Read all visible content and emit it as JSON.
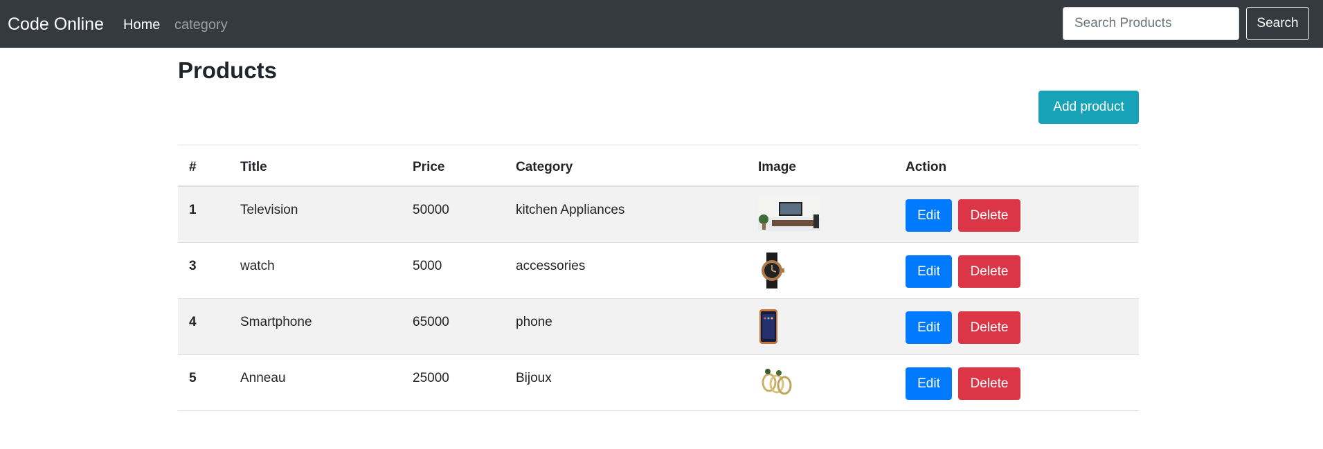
{
  "navbar": {
    "brand": "Code Online",
    "links": [
      {
        "label": "Home"
      },
      {
        "label": "category"
      }
    ],
    "search": {
      "placeholder": "Search Products",
      "value": "",
      "button_label": "Search"
    }
  },
  "main": {
    "title": "Products",
    "add_button_label": "Add product",
    "table": {
      "columns": [
        "#",
        "Title",
        "Price",
        "Category",
        "Image",
        "Action"
      ],
      "rows": [
        {
          "id": "1",
          "title": "Television",
          "price": "50000",
          "category": "kitchen Appliances",
          "image": "television-thumbnail",
          "edit_label": "Edit",
          "delete_label": "Delete"
        },
        {
          "id": "3",
          "title": "watch",
          "price": "5000",
          "category": "accessories",
          "image": "watch-thumbnail",
          "edit_label": "Edit",
          "delete_label": "Delete"
        },
        {
          "id": "4",
          "title": "Smartphone",
          "price": "65000",
          "category": "phone",
          "image": "smartphone-thumbnail",
          "edit_label": "Edit",
          "delete_label": "Delete"
        },
        {
          "id": "5",
          "title": "Anneau",
          "price": "25000",
          "category": "Bijoux",
          "image": "ring-thumbnail",
          "edit_label": "Edit",
          "delete_label": "Delete"
        }
      ]
    }
  },
  "colors": {
    "navbar_bg": "#343a40",
    "info": "#17a2b8",
    "primary": "#007bff",
    "danger": "#dc3545",
    "stripe": "#f2f2f2"
  }
}
